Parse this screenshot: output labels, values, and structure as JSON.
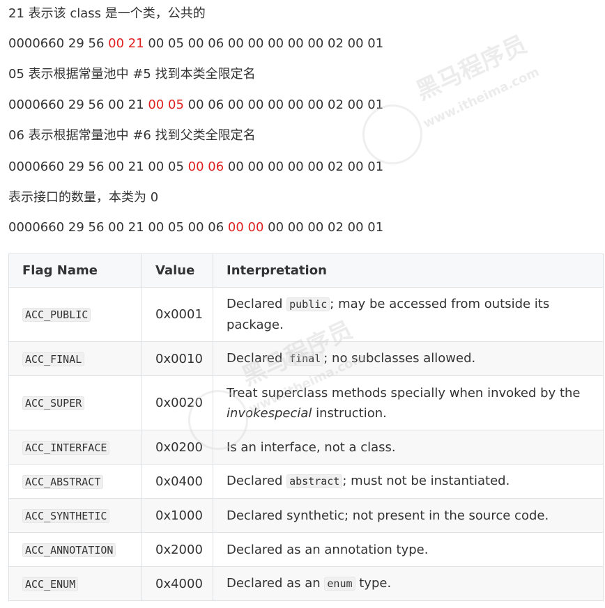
{
  "paragraphs": [
    {
      "parts": [
        "21 表示该 class 是一个类，公共的"
      ]
    },
    {
      "before": "0000660 29 56 ",
      "highlight": "00 21",
      "after": " 00 05 00 06 00 00 00 00 00 02 00 01"
    },
    {
      "parts": [
        "05 表示根据常量池中 #5 找到本类全限定名"
      ]
    },
    {
      "before": "0000660 29 56 00 21 ",
      "highlight": "00 05",
      "after": " 00 06 00 00 00 00 00 02 00 01"
    },
    {
      "parts": [
        "06 表示根据常量池中 #6 找到父类全限定名"
      ]
    },
    {
      "before": "0000660 29 56 00 21 00 05 ",
      "highlight": "00 06",
      "after": " 00 00 00 00 00 02 00 01"
    },
    {
      "parts": [
        "表示接口的数量，本类为 0"
      ]
    },
    {
      "before": "0000660 29 56 00 21 00 05 00 06 ",
      "highlight": "00 00",
      "after": " 00 00 00 02 00 01"
    }
  ],
  "table": {
    "headers": [
      "Flag Name",
      "Value",
      "Interpretation"
    ],
    "rows": [
      {
        "flag": "ACC_PUBLIC",
        "value": "0x0001",
        "pre": "Declared ",
        "code": "public",
        "post": "; may be accessed from outside its package."
      },
      {
        "flag": "ACC_FINAL",
        "value": "0x0010",
        "pre": "Declared ",
        "code": "final",
        "post": "; no subclasses allowed."
      },
      {
        "flag": "ACC_SUPER",
        "value": "0x0020",
        "pre": "Treat superclass methods specially when invoked by the ",
        "em": "invokespecial",
        "post": " instruction."
      },
      {
        "flag": "ACC_INTERFACE",
        "value": "0x0200",
        "pre": "Is an interface, not a class."
      },
      {
        "flag": "ACC_ABSTRACT",
        "value": "0x0400",
        "pre": "Declared ",
        "code": "abstract",
        "post": "; must not be instantiated."
      },
      {
        "flag": "ACC_SYNTHETIC",
        "value": "0x1000",
        "pre": "Declared synthetic; not present in the source code."
      },
      {
        "flag": "ACC_ANNOTATION",
        "value": "0x2000",
        "pre": "Declared as an annotation type."
      },
      {
        "flag": "ACC_ENUM",
        "value": "0x4000",
        "pre": "Declared as an ",
        "code": "enum",
        "post": " type."
      }
    ]
  },
  "watermark": {
    "brand": "黑马程序员",
    "url": "www.itheima.com"
  },
  "colors": {
    "highlight": "#e02020",
    "text": "#333333",
    "table_border": "#dfe2e5",
    "header_bg": "#f6f8fa"
  }
}
